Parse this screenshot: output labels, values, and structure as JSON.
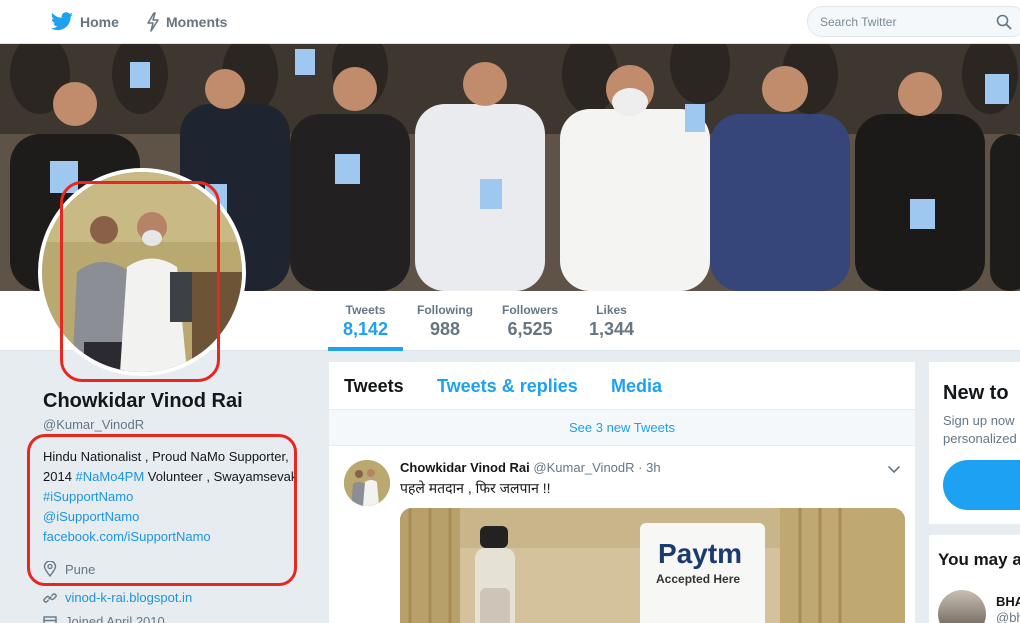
{
  "nav": {
    "home_label": "Home",
    "moments_label": "Moments",
    "search_placeholder": "Search Twitter"
  },
  "stats": [
    {
      "label": "Tweets",
      "value": "8,142"
    },
    {
      "label": "Following",
      "value": "988"
    },
    {
      "label": "Followers",
      "value": "6,525"
    },
    {
      "label": "Likes",
      "value": "1,344"
    }
  ],
  "profile": {
    "name": "Chowkidar Vinod Rai",
    "handle": "@Kumar_VinodR",
    "bio_parts": {
      "p1": "Hindu Nationalist , Proud NaMo Supporter, 2014 ",
      "hashtag1": "#NaMo4PM",
      "p2": " Volunteer , Swayamsevak ",
      "hashtag2": "#iSupportNamo",
      "mention": "@iSupportNamo",
      "fb": "facebook.com/iSupportNamo"
    },
    "location": "Pune",
    "website": "vinod-k-rai.blogspot.in",
    "joined": "Joined April 2010"
  },
  "timeline": {
    "tabs": [
      "Tweets",
      "Tweets & replies",
      "Media"
    ],
    "new_tweets": "See 3 new Tweets",
    "tweet": {
      "author": "Chowkidar Vinod Rai",
      "handle": "@Kumar_VinodR",
      "time": "· 3h",
      "text": "पहले मतदान , फिर जलपान !!",
      "media_text_1": "Paytm",
      "media_text_2": "Accepted Here"
    }
  },
  "sidebar": {
    "new_title": "New to",
    "new_text_1": "Sign up now",
    "new_text_2": "personalized",
    "may_title": "You may a",
    "suggest_name": "BHA",
    "suggest_handle": "@bh"
  },
  "colors": {
    "accent": "#1da1f2",
    "highlight": "#e8271e"
  }
}
